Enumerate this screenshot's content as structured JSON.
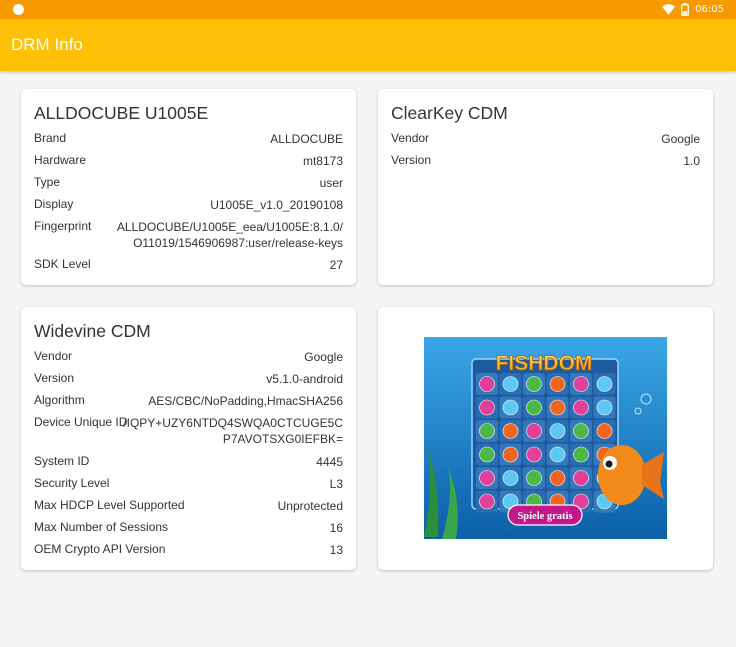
{
  "status_bar": {
    "time": "06:05",
    "icons": [
      "notification-dot-icon",
      "wifi-icon",
      "battery-icon"
    ]
  },
  "app_bar": {
    "title": "DRM Info"
  },
  "colors": {
    "status_bar": "#f79a00",
    "app_bar": "#ffc107",
    "background": "#f5f5f5",
    "card": "#ffffff"
  },
  "device_card": {
    "title": "ALLDOCUBE U1005E",
    "rows": [
      {
        "label": "Brand",
        "value": "ALLDOCUBE"
      },
      {
        "label": "Hardware",
        "value": "mt8173"
      },
      {
        "label": "Type",
        "value": "user"
      },
      {
        "label": "Display",
        "value": "U1005E_v1.0_20190108"
      },
      {
        "label": "Fingerprint",
        "value_lines": [
          "ALLDOCUBE/U1005E_eea/U1005E:8.1.0/",
          "O11019/1546906987:user/release-keys"
        ]
      },
      {
        "label": "SDK Level",
        "value": "27"
      }
    ]
  },
  "clearkey_card": {
    "title": "ClearKey CDM",
    "rows": [
      {
        "label": "Vendor",
        "value": "Google"
      },
      {
        "label": "Version",
        "value": "1.0"
      }
    ]
  },
  "widevine_card": {
    "title": "Widevine CDM",
    "rows": [
      {
        "label": "Vendor",
        "value": "Google"
      },
      {
        "label": "Version",
        "value": "v5.1.0-android"
      },
      {
        "label": "Algorithm",
        "value": "AES/CBC/NoPadding,HmacSHA256"
      },
      {
        "label": "Device Unique ID",
        "value_lines": [
          "/IQPY+UZY6NTDQ4SWQA0CTCUGE5C",
          "P7AVOTSXG0IEFBK="
        ]
      },
      {
        "label": "System ID",
        "value": "4445"
      },
      {
        "label": "Security Level",
        "value": "L3"
      },
      {
        "label": "Max HDCP Level Supported",
        "value": "Unprotected"
      },
      {
        "label": "Max Number of Sessions",
        "value": "16"
      },
      {
        "label": "OEM Crypto API Version",
        "value": "13"
      }
    ]
  },
  "ad_card": {
    "game_title": "FISHDOM",
    "cta_label": "Spiele gratis"
  }
}
